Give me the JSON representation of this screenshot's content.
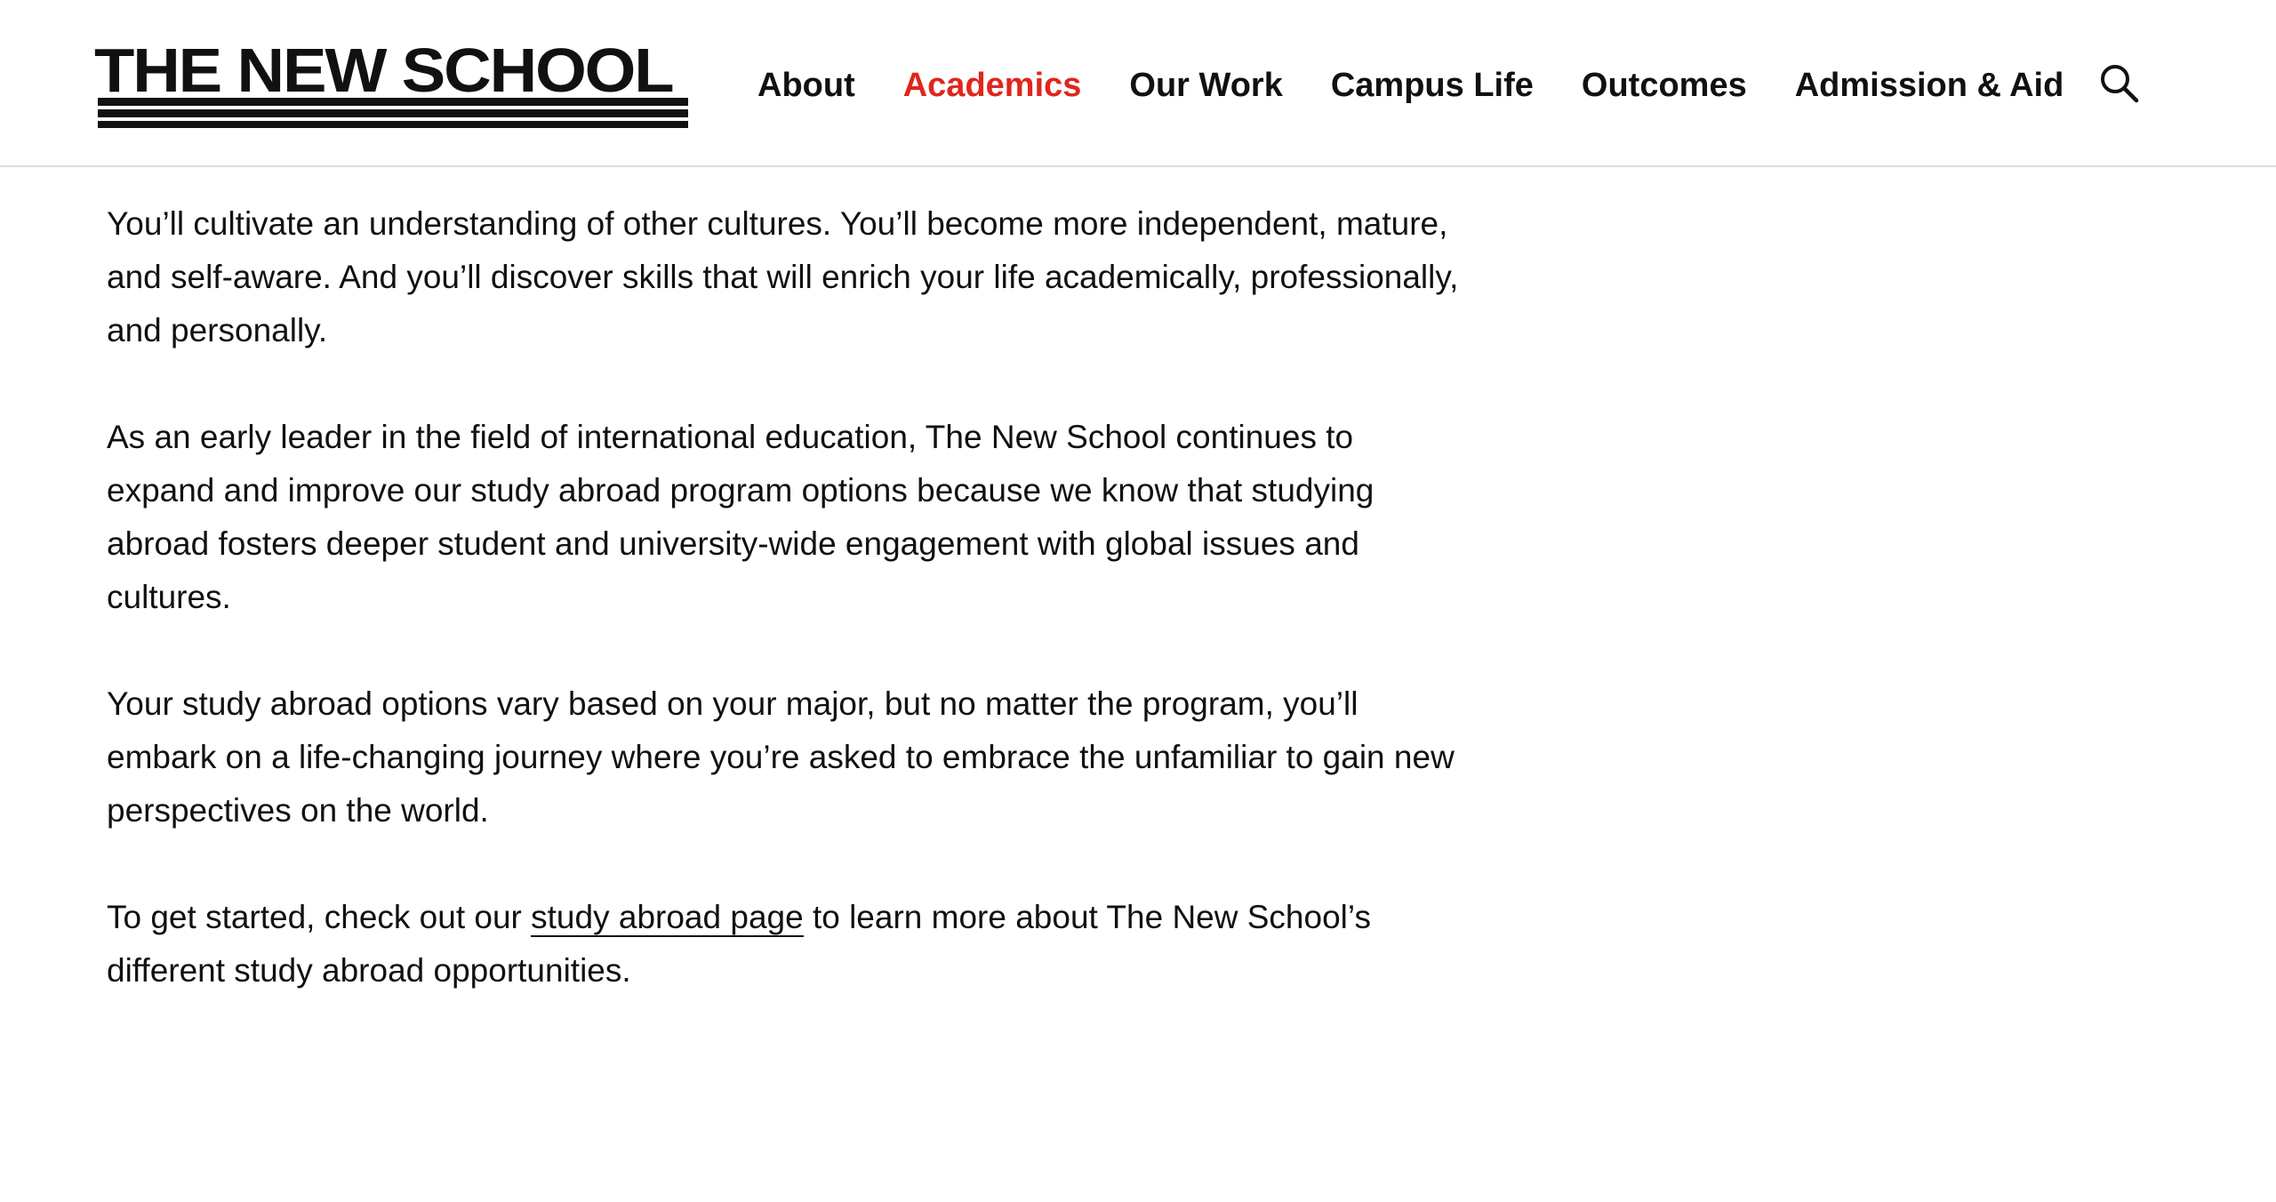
{
  "header": {
    "logo_text": "THE NEW SCHOOL",
    "nav": [
      {
        "label": "About",
        "active": false
      },
      {
        "label": "Academics",
        "active": true
      },
      {
        "label": "Our Work",
        "active": false
      },
      {
        "label": "Campus Life",
        "active": false
      },
      {
        "label": "Outcomes",
        "active": false
      },
      {
        "label": "Admission & Aid",
        "active": false
      }
    ],
    "search_icon": "search-icon"
  },
  "content": {
    "p1": "You’ll cultivate an understanding of other cultures. You’ll become more independent, mature, and self-aware. And you’ll discover skills that will enrich your life academically, professionally, and personally.",
    "p2": "As an early leader in the field of international education, The New School continues to expand and improve our study abroad program options because we know that studying abroad fosters deeper student and university-wide engagement with global issues and cultures.",
    "p3": "Your study abroad options vary based on your major, but no matter the program, you’ll embark on a life-changing journey where you’re asked to embrace the unfamiliar to gain new perspectives on the world.",
    "p4_before": "To get started, check out our ",
    "p4_link": "study abroad page",
    "p4_after": " to learn more about The New School’s different study abroad opportunities."
  },
  "colors": {
    "accent": "#e0261c",
    "text": "#111111",
    "border": "#dcdcdc"
  }
}
